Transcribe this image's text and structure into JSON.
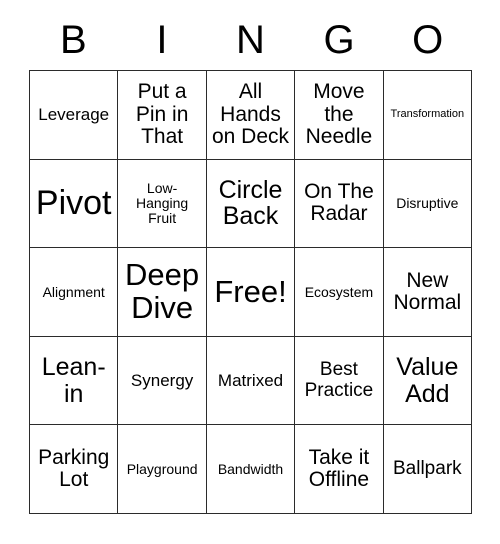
{
  "card": {
    "header_letters": [
      "B",
      "I",
      "N",
      "G",
      "O"
    ],
    "rows": [
      [
        {
          "text": "Leverage",
          "size": "fs-xs"
        },
        {
          "text": "Put a\nPin in\nThat",
          "size": "fs-m"
        },
        {
          "text": "All\nHands\non Deck",
          "size": "fs-m"
        },
        {
          "text": "Move\nthe\nNeedle",
          "size": "fs-m"
        },
        {
          "text": "Transformation",
          "size": "fs-tiny"
        }
      ],
      [
        {
          "text": "Pivot",
          "size": "fs-xxl"
        },
        {
          "text": "Low-\nHanging\nFruit",
          "size": "fs-xxs"
        },
        {
          "text": "Circle\nBack",
          "size": "fs-l"
        },
        {
          "text": "On The\nRadar",
          "size": "fs-m"
        },
        {
          "text": "Disruptive",
          "size": "fs-xxs"
        }
      ],
      [
        {
          "text": "Alignment",
          "size": "fs-xxs"
        },
        {
          "text": "Deep\nDive",
          "size": "fs-xl"
        },
        {
          "text": "Free!",
          "size": "fs-xl"
        },
        {
          "text": "Ecosystem",
          "size": "fs-xxs"
        },
        {
          "text": "New\nNormal",
          "size": "fs-m"
        }
      ],
      [
        {
          "text": "Lean-\nin",
          "size": "fs-l"
        },
        {
          "text": "Synergy",
          "size": "fs-xs"
        },
        {
          "text": "Matrixed",
          "size": "fs-xs"
        },
        {
          "text": "Best\nPractice",
          "size": "fs-s"
        },
        {
          "text": "Value\nAdd",
          "size": "fs-l"
        }
      ],
      [
        {
          "text": "Parking\nLot",
          "size": "fs-m"
        },
        {
          "text": "Playground",
          "size": "fs-xxs"
        },
        {
          "text": "Bandwidth",
          "size": "fs-xxs"
        },
        {
          "text": "Take it\nOffline",
          "size": "fs-m"
        },
        {
          "text": "Ballpark",
          "size": "fs-s"
        }
      ]
    ],
    "free_space_label": "Free!",
    "colors": {
      "background": "#ffffff",
      "border": "#2b2b2b",
      "text": "#000000"
    }
  }
}
